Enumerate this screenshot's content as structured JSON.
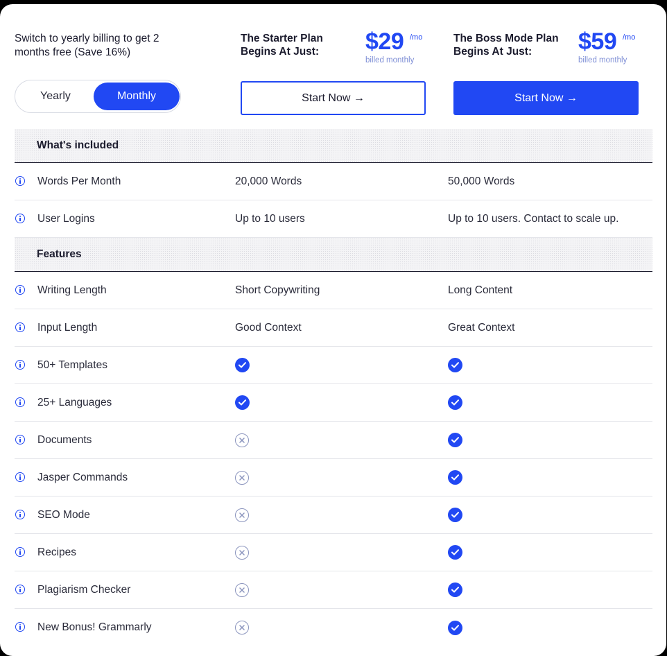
{
  "promo_text": "Switch to yearly billing to get 2 months free (Save 16%)",
  "billing_toggle": {
    "yearly_label": "Yearly",
    "monthly_label": "Monthly",
    "selected": "Monthly"
  },
  "plans": [
    {
      "title": "The Starter Plan Begins At Just:",
      "price": "$29",
      "per": "/mo",
      "billed": "billed monthly",
      "cta": "Start Now →"
    },
    {
      "title": "The Boss Mode Plan Begins At Just:",
      "price": "$59",
      "per": "/mo",
      "billed": "billed monthly",
      "cta": "Start Now →"
    }
  ],
  "sections": [
    {
      "title": "What's included",
      "rows": [
        {
          "label": "Words Per Month",
          "starter": "20,000 Words",
          "boss": "50,000 Words"
        },
        {
          "label": "User Logins",
          "starter": "Up to 10 users",
          "boss": "Up to 10 users. Contact to scale up."
        }
      ]
    },
    {
      "title": "Features",
      "rows": [
        {
          "label": "Writing Length",
          "starter": "Short Copywriting",
          "boss": "Long Content"
        },
        {
          "label": "Input Length",
          "starter": "Good Context",
          "boss": "Great Context"
        },
        {
          "label": "50+ Templates",
          "starter": "check",
          "boss": "check"
        },
        {
          "label": "25+ Languages",
          "starter": "check",
          "boss": "check"
        },
        {
          "label": "Documents",
          "starter": "cross",
          "boss": "check"
        },
        {
          "label": "Jasper Commands",
          "starter": "cross",
          "boss": "check"
        },
        {
          "label": "SEO Mode",
          "starter": "cross",
          "boss": "check"
        },
        {
          "label": "Recipes",
          "starter": "cross",
          "boss": "check"
        },
        {
          "label": "Plagiarism Checker",
          "starter": "cross",
          "boss": "check"
        },
        {
          "label": "New Bonus! Grammarly",
          "starter": "cross",
          "boss": "check"
        }
      ]
    }
  ],
  "colors": {
    "accent": "#2148f3",
    "text": "#1c1c2e",
    "muted": "#8b95be"
  },
  "icons": {
    "info": "info-icon",
    "check": "check-circle-icon",
    "cross": "x-circle-icon"
  }
}
